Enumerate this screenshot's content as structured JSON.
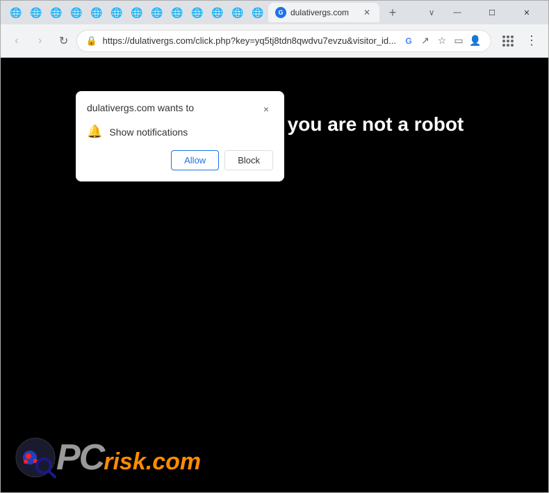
{
  "browser": {
    "tabs": [
      {
        "favicon": "G",
        "title": "dulativergs.com",
        "active": true
      }
    ],
    "url": "https://dulativergs.com/click.php?key=yq5tj8tdn8qwdvu7evzu&visitor_id...",
    "window_controls": {
      "minimize": "—",
      "maximize": "☐",
      "close": "✕"
    }
  },
  "popup": {
    "title": "dulativergs.com wants to",
    "permission_label": "Show notifications",
    "allow_button": "Allow",
    "block_button": "Block",
    "close_button": "×"
  },
  "page": {
    "partial_text": "at you are not a robot"
  },
  "logo": {
    "pc": "PC",
    "suffix": "risk.com"
  },
  "nav": {
    "back": "‹",
    "forward": "›",
    "refresh": "↻"
  }
}
